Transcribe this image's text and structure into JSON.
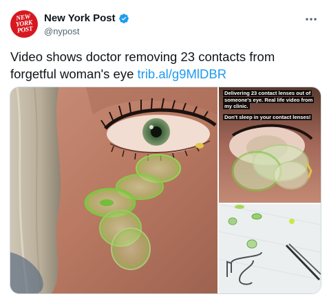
{
  "account": {
    "display_name": "New York Post",
    "handle": "@nypost",
    "avatar_text": [
      "NEW",
      "YORK",
      "POST"
    ],
    "avatar_color": "#d7191f",
    "verified_icon": "verified-badge-icon",
    "verified_color": "#1d9bf0"
  },
  "tweet": {
    "text": "Video shows doctor removing 23 contacts from forgetful woman's eye ",
    "link": "trib.al/g9MlDBR",
    "link_color": "#1d9bf0",
    "more_icon": "more-options-icon"
  },
  "media": {
    "caption_lines": [
      "Delivering 23 contact lenses out of",
      "someone's eye. Real life video from",
      "my clinic.",
      "Don't sleep in your contact lenses!"
    ]
  }
}
